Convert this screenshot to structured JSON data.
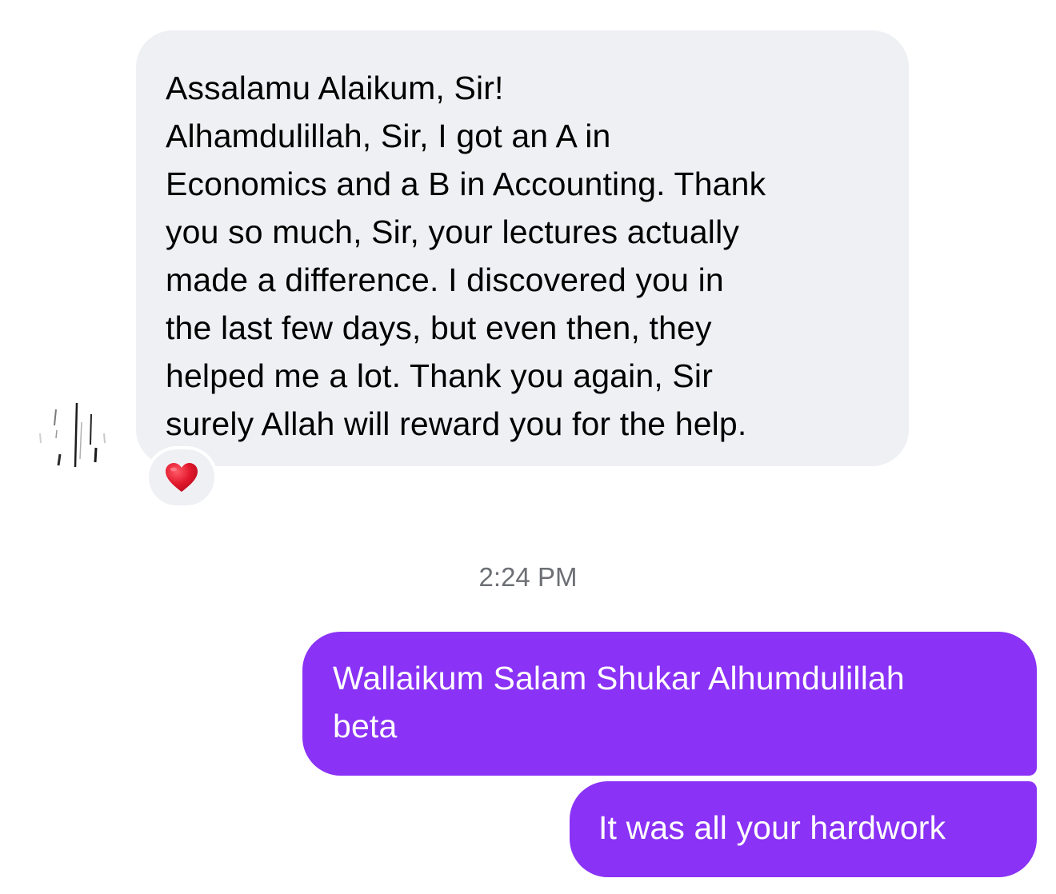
{
  "incoming_message": {
    "lines": [
      "Assalamu Alaikum, Sir!",
      "Alhamdulillah, Sir, I got an A in",
      "Economics and a B in Accounting. Thank",
      "you so much, Sir, your lectures actually",
      "made a difference. I discovered you in",
      "the last few days, but even then, they",
      "helped me a lot. Thank you again, Sir",
      "surely Allah will reward you for the help."
    ],
    "reaction_icon": "red-heart-icon"
  },
  "timestamp": "2:24 PM",
  "outgoing_messages": [
    {
      "lines": [
        "Wallaikum Salam Shukar Alhumdulillah",
        "beta"
      ]
    },
    {
      "lines": [
        "It was all your hardwork"
      ]
    }
  ],
  "colors": {
    "incoming_bubble": "#eff0f4",
    "outgoing_bubble": "#8a32f6",
    "outgoing_text": "#ffffff",
    "timestamp_text": "#6d6f75",
    "reaction_heart": "#e0162b"
  }
}
